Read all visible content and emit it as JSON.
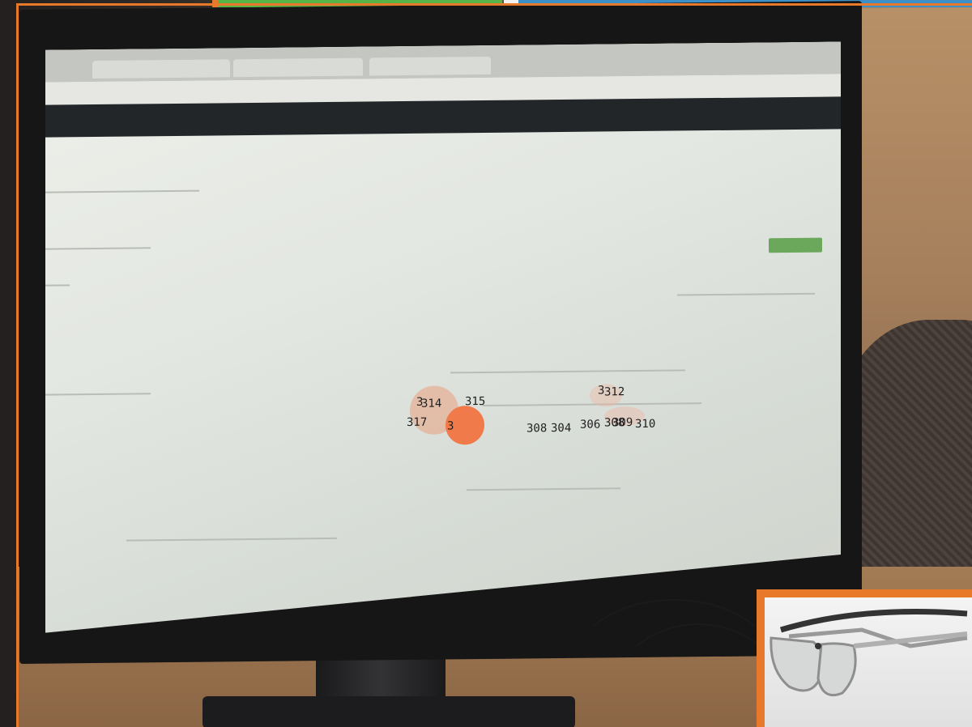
{
  "gaze": {
    "labels": [
      "3",
      "314",
      "315",
      "3",
      "312",
      "317",
      "3",
      "308",
      "304",
      "306",
      "308",
      "309",
      "310"
    ]
  },
  "colors": {
    "border": "#e8782a",
    "bar_green": "#59b447",
    "bar_blue": "#3d8fc8",
    "gaze_dot": "#f07a4a"
  },
  "icons": [
    "eye-tracking-glasses-icon"
  ]
}
